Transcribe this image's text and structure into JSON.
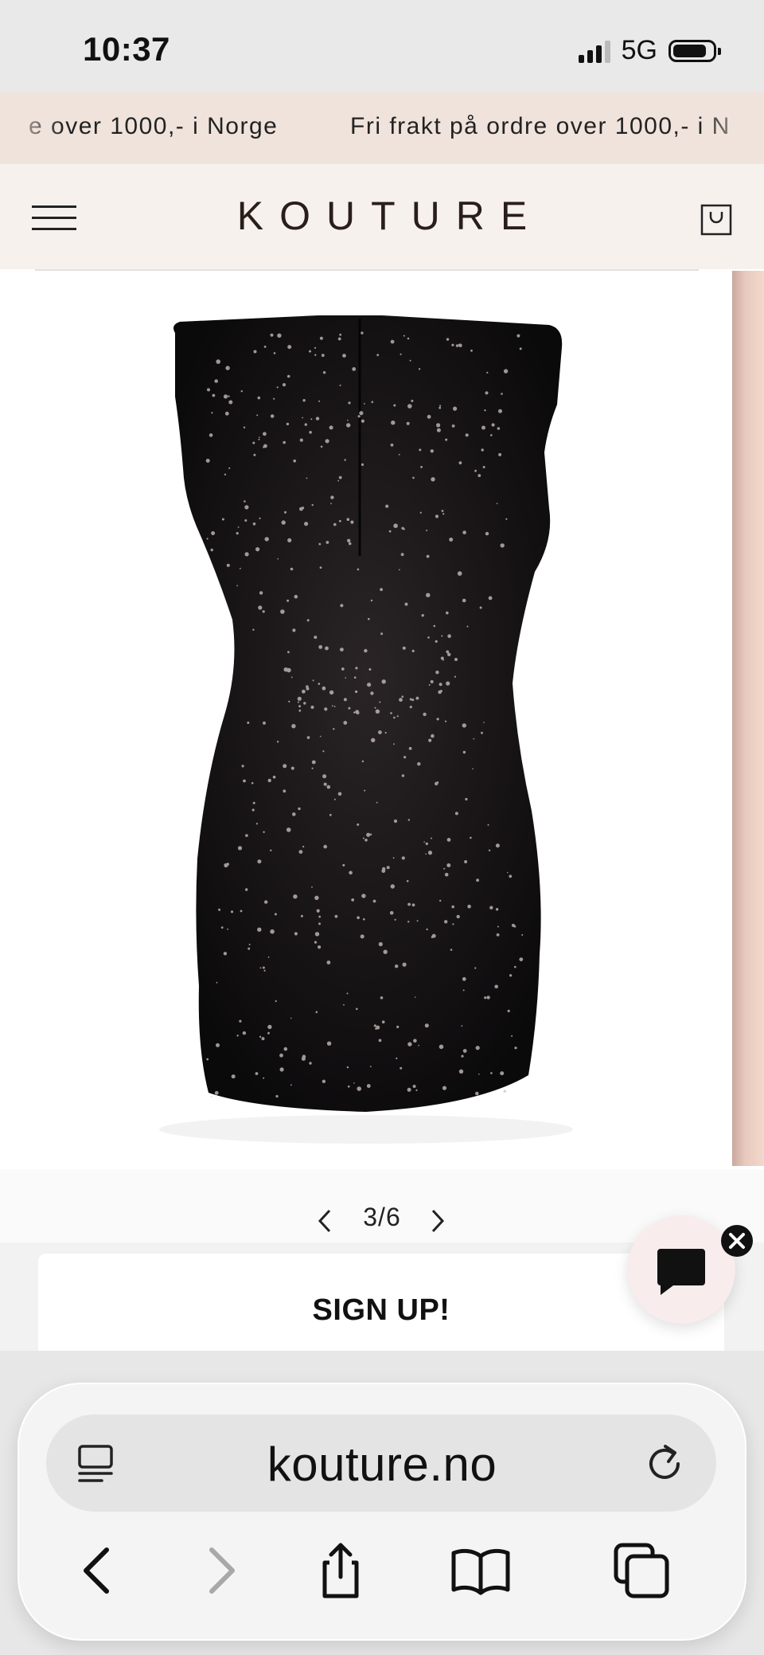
{
  "status_bar": {
    "time": "10:37",
    "network": "5G",
    "battery_level": 0.85
  },
  "promo": {
    "message_fragment": "e over 1000,- i Norge",
    "message_next": "Fri frakt på ordre over 1000,- i N"
  },
  "header": {
    "logo": "KOUTURE",
    "menu_icon": "hamburger-menu-icon",
    "cart_icon": "shopping-bag-icon"
  },
  "gallery": {
    "current": "3/6",
    "product_image": "black sequin sleeveless mini dress (back view)",
    "prev_icon": "chevron-left-icon",
    "next_icon": "chevron-right-icon"
  },
  "signup": {
    "label": "SIGN UP!"
  },
  "chat": {
    "icon": "chat-bubble-icon",
    "close_icon": "close-icon"
  },
  "browser": {
    "url": "kouture.no",
    "icons": [
      "reader-mode-icon",
      "reload-icon",
      "back-icon",
      "forward-icon",
      "share-icon",
      "bookmarks-icon",
      "tabs-icon"
    ],
    "forward_disabled": true
  },
  "colors": {
    "promo_bg": "#efe3dc",
    "header_bg": "#f7f1ee",
    "logo": "#2a1e1a",
    "chat_bg": "#f8ecec"
  }
}
